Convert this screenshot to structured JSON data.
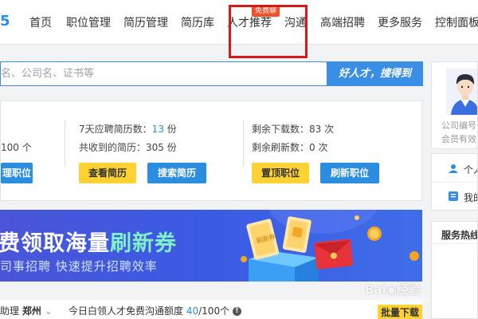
{
  "nav": {
    "logo_fragment": "5",
    "items": [
      "首页",
      "职位管理",
      "简历管理",
      "简历库",
      "人才推荐",
      "沟通",
      "高端招聘",
      "更多服务",
      "控制面板"
    ],
    "badge": "免费聊",
    "highlight_color": "#d7191c"
  },
  "search": {
    "placeholder": "名、公司名、证书等",
    "button_label": "好人才，搜得到"
  },
  "stats": {
    "col1": {
      "line1_value": "100",
      "line1_unit": "个",
      "button": "理职位"
    },
    "col2": {
      "line1_label": "7天应聘简历数：",
      "line1_value": "13",
      "line1_unit": "份",
      "line2_label": "共收到的简历：",
      "line2_value": "305",
      "line2_unit": "份",
      "button_left": "查看简历",
      "button_right": "搜索简历"
    },
    "col3": {
      "line1_label": "剩余下载数：",
      "line1_value": "83",
      "line1_unit": "次",
      "line2_label": "剩余刷新数：",
      "line2_value": "0",
      "line2_unit": "次",
      "button_left": "置顶职位",
      "button_right": "刷新职位"
    }
  },
  "banner": {
    "title_prefix": "费领取海量",
    "title_highlight": "刷新券",
    "subtitle": "司事招聘   快速提升招聘效率",
    "coupon_label": "刷新券"
  },
  "bottom": {
    "prefix": "助理",
    "city": "郑州",
    "chevron": "⌄",
    "quota_label": "今日白领人才免费沟通额度",
    "quota_used": "40",
    "quota_total": "/100个",
    "info": "!",
    "bulk_download": "批量下载"
  },
  "profile": {
    "company_id_label": "公司编号",
    "member_label": "会员有效"
  },
  "menu": {
    "item1": "个人",
    "item2": "我的"
  },
  "service": {
    "title": "服务热线"
  },
  "watermark": {
    "brand": "Bai◉经验",
    "url": "jingyan.baidu.com"
  },
  "colors": {
    "primary": "#2a8de0",
    "accent_yellow": "#ffd234",
    "banner_bg": "#3a5be3",
    "badge_red": "#f0502a"
  }
}
